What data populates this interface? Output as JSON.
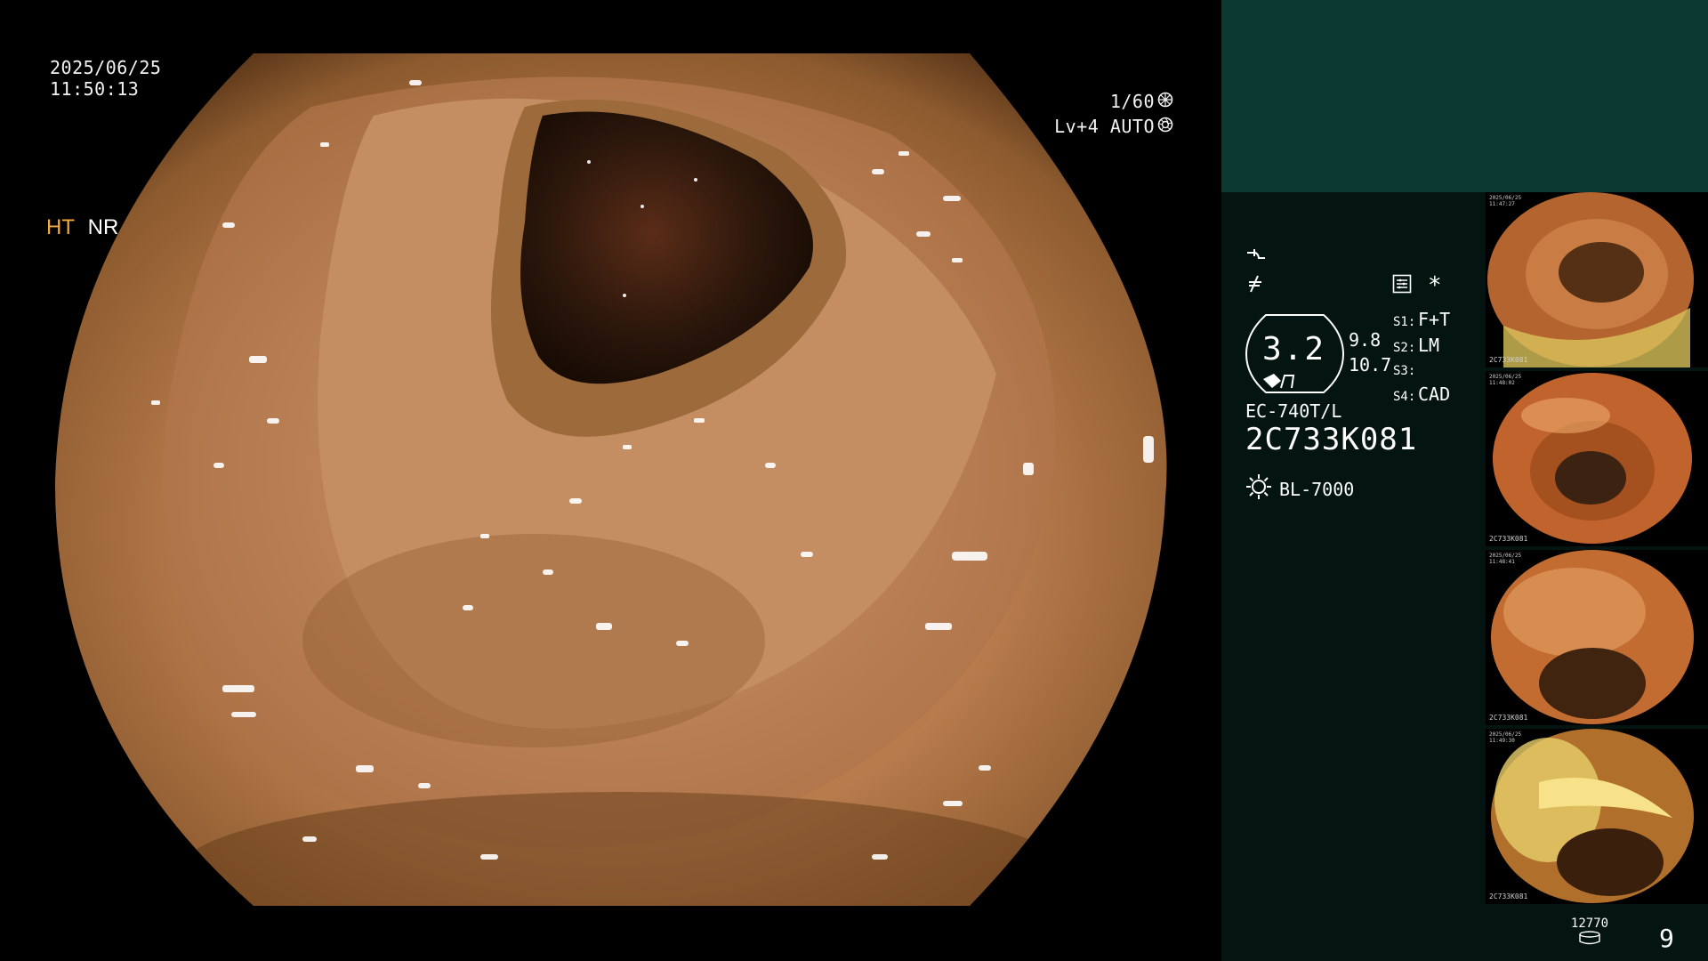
{
  "osd": {
    "date": "2025/06/25",
    "time": "11:50:13",
    "shutter": "1/60",
    "brightness": "Lv+4 AUTO"
  },
  "panel": {
    "modes": {
      "ht": "HT",
      "nr": "NR"
    },
    "zoom_value": "3.2",
    "side_values": [
      "9.8",
      "10.7"
    ],
    "switches": [
      {
        "key": "S1:",
        "value": "F+T"
      },
      {
        "key": "S2:",
        "value": "LM"
      },
      {
        "key": "S3:",
        "value": ""
      },
      {
        "key": "S4:",
        "value": "CAD"
      }
    ],
    "asterisk": "*",
    "scope_model": "EC-740T/L",
    "scope_serial": "2C733K081",
    "light_source": "BL-7000",
    "storage_count": "12770",
    "page_number": "9"
  },
  "thumbnails": [
    {
      "label": "2C733K081",
      "date": "2025/06/25\n11:47:27",
      "palette": [
        "#b4642f",
        "#e2a862",
        "#553014"
      ]
    },
    {
      "label": "2C733K081",
      "date": "2025/06/25\n11:48:02",
      "palette": [
        "#c0632c",
        "#eeaa6b",
        "#3c2210"
      ]
    },
    {
      "label": "2C733K081",
      "date": "2025/06/25\n11:48:41",
      "palette": [
        "#c36c32",
        "#f0b46e",
        "#40240f"
      ]
    },
    {
      "label": "2C733K081",
      "date": "2025/06/25\n11:49:30",
      "palette": [
        "#b0702b",
        "#f7e28a",
        "#3a1f0c"
      ]
    }
  ],
  "colors": {
    "panel_bg": "#041511",
    "panel_top": "#0c3a33",
    "accent_ht": "#f4a93c"
  },
  "icons": {
    "shutter": "shutter-icon",
    "auto_iris": "iris-icon",
    "light_source": "sun-icon",
    "storage": "storage-icon",
    "settings": "menu-box-icon"
  }
}
